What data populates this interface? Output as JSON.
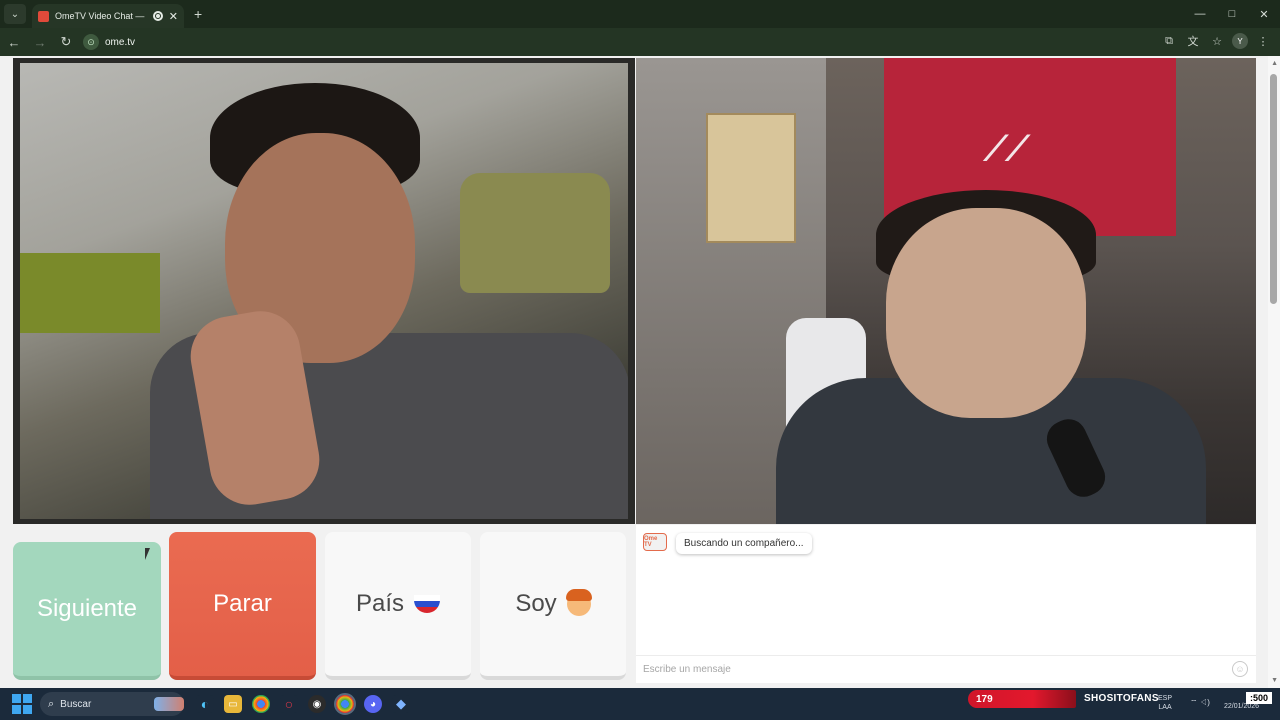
{
  "browser": {
    "tab_title": "OmeTV Video Chat — Ome",
    "tab_close": "✕",
    "new_tab": "+",
    "url": "ome.tv",
    "window_controls": {
      "minimize": "—",
      "maximize": "□",
      "close": "✕"
    },
    "profile_initial": "Y"
  },
  "controls": {
    "next_label": "Siguiente",
    "stop_label": "Parar",
    "country_label": "País",
    "gender_label": "Soy"
  },
  "chat": {
    "logo_text": "Ome TV",
    "status_message": "Buscando un compañero...",
    "input_placeholder": "Escribe un mensaje"
  },
  "taskbar": {
    "search_label": "Buscar",
    "live_count": "179",
    "live_name": "SHOSITOFANS",
    "lang_top": "ESP",
    "lang_bottom": "LAA",
    "clock_time": ":500",
    "clock_date": "22/01/2026"
  },
  "colors": {
    "next_button": "#a3d7bd",
    "stop_button": "#e35f48",
    "neutral_button": "#f8f8f8",
    "accent": "#e36b4c"
  }
}
